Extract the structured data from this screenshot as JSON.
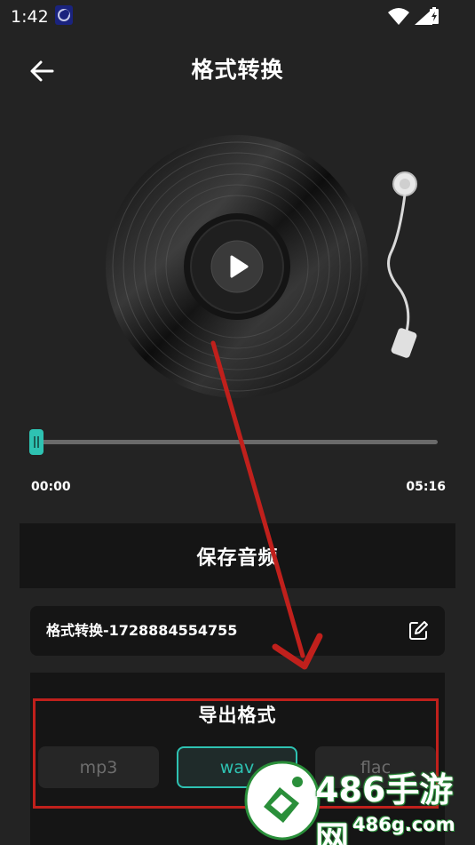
{
  "status_bar": {
    "time": "1:42",
    "icons": [
      "app-icon",
      "wifi-icon",
      "signal-icon",
      "battery-icon"
    ]
  },
  "header": {
    "title": "格式转换",
    "back_icon": "arrow-left-icon"
  },
  "player": {
    "play_icon": "play-icon",
    "progress": 0.0,
    "current_time": "00:00",
    "total_time": "05:16"
  },
  "save": {
    "label": "保存音频"
  },
  "file": {
    "name": "格式转换-1728884554755",
    "edit_icon": "edit-icon"
  },
  "export": {
    "title": "导出格式",
    "formats": [
      "mp3",
      "wav",
      "flac"
    ],
    "selected": "wav"
  },
  "watermark": {
    "brand": "486手游网",
    "url": "486g.com"
  },
  "colors": {
    "background": "#232323",
    "panel": "#151515",
    "accent": "#2ec2b2",
    "annotation": "#c0201c"
  }
}
